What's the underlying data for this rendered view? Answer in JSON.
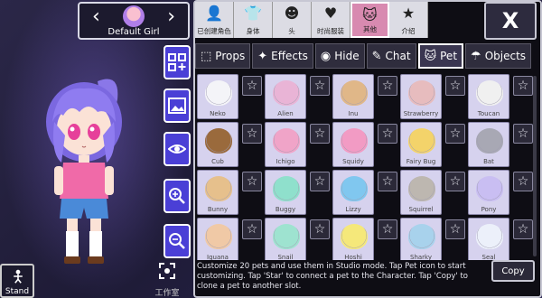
{
  "character": {
    "name": "Default Girl",
    "prev_arrow": "‹",
    "next_arrow": "›"
  },
  "left_buttons": {
    "stand_label": "Stand",
    "studio_label": "工作室"
  },
  "categories": [
    {
      "label": "已创建角色",
      "icon": "person-icon"
    },
    {
      "label": "身体",
      "icon": "shirt-icon"
    },
    {
      "label": "头",
      "icon": "hair-icon"
    },
    {
      "label": "时尚服装",
      "icon": "outfit-icon"
    },
    {
      "label": "其他",
      "icon": "cat-dog-icon",
      "active": true
    },
    {
      "label": "介绍",
      "icon": "profile-star-icon"
    }
  ],
  "close_label": "X",
  "subtabs": [
    {
      "label": "Props",
      "icon": "box-icon"
    },
    {
      "label": "Effects",
      "icon": "sparkle-icon"
    },
    {
      "label": "Hide",
      "icon": "eye-icon"
    },
    {
      "label": "Chat",
      "icon": "chat-icon"
    },
    {
      "label": "Pet",
      "icon": "cat-icon",
      "active": true
    },
    {
      "label": "Objects",
      "icon": "umbrella-icon"
    }
  ],
  "pets": [
    {
      "name": "Neko",
      "color": "#f4f4f8"
    },
    {
      "name": "Alien",
      "color": "#e9b4d6"
    },
    {
      "name": "Inu",
      "color": "#e0b788"
    },
    {
      "name": "Strawberry",
      "color": "#e7bcbe"
    },
    {
      "name": "Toucan",
      "color": "#f0f0f0"
    },
    {
      "name": "Cub",
      "color": "#9a6a3c"
    },
    {
      "name": "Ichigo",
      "color": "#f0a4c8"
    },
    {
      "name": "Squidy",
      "color": "#f29bc4"
    },
    {
      "name": "Fairy Bug",
      "color": "#f3d36a"
    },
    {
      "name": "Bat",
      "color": "#a8a8b4"
    },
    {
      "name": "Bunny",
      "color": "#e6c08c"
    },
    {
      "name": "Buggy",
      "color": "#8fe0cc"
    },
    {
      "name": "Lizzy",
      "color": "#80c7ef"
    },
    {
      "name": "Squirrel",
      "color": "#bdb7b0"
    },
    {
      "name": "Pony",
      "color": "#c9bef2"
    },
    {
      "name": "Iguana",
      "color": "#f0c9a6"
    },
    {
      "name": "Snail",
      "color": "#9ee3d0"
    },
    {
      "name": "Hoshi",
      "color": "#f5e87a"
    },
    {
      "name": "Sharky",
      "color": "#a8d2ec"
    },
    {
      "name": "Seal",
      "color": "#ecf0fa"
    }
  ],
  "star_glyph": "☆",
  "info_text": "Customize 20 pets and use them in Studio mode. Tap Pet icon to start customizing. Tap 'Star' to connect a pet to the Character. Tap 'Copy' to clone a pet to another slot.",
  "copy_label": "Copy",
  "colors": {
    "tool_blue": "#4a3fd6",
    "active_tab_pink": "#d88ab0",
    "panel_bg": "#0e0d14"
  }
}
